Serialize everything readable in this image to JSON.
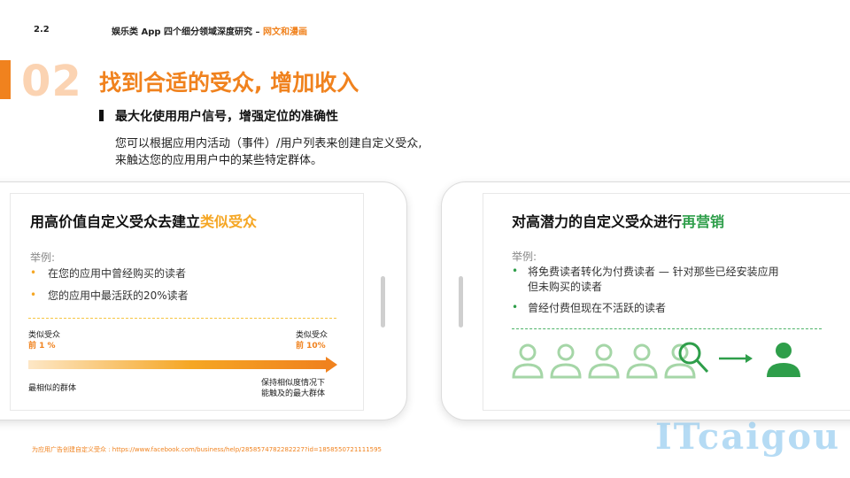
{
  "header": {
    "section_number": "2.2",
    "title": "娱乐类 App 四个细分领域深度研究 – ",
    "title_accent": "网文和漫画"
  },
  "slide": {
    "big_number": "02",
    "title": "找到合适的受众, 增加收入",
    "subtitle": "最大化使用用户信号，增强定位的准确性",
    "description_line1": "您可以根据应用内活动（事件）/用户列表来创建自定义受众,",
    "description_line2": "来触达您的应用用户中的某些特定群体。"
  },
  "left_card": {
    "title_prefix": "用高价值自定义受众去建立",
    "title_highlight": "类似受众",
    "example_label": "举例:",
    "bullets": [
      "在您的应用中曾经购买的读者",
      "您的应用中最活跃的20%读者"
    ],
    "scale": {
      "left_label_line1": "类似受众",
      "left_label_line2": "前 1 %",
      "right_label_line1": "类似受众",
      "right_label_line2": "前 10%",
      "left_caption": "最相似的群体",
      "right_caption_line1": "保持相似度情况下",
      "right_caption_line2": "能触及的最大群体"
    }
  },
  "right_card": {
    "title_prefix": "对高潜力的自定义受众进行",
    "title_highlight": "再营销",
    "example_label": "举例:",
    "bullets": [
      {
        "line1": "将免费读者转化为付费读者 — 针对那些已经安装应用",
        "line2": "但未购买的读者"
      },
      {
        "line1": "曾经付费但现在不活跃的读者",
        "line2": ""
      }
    ],
    "icons": [
      "person-outline-icon",
      "person-outline-icon",
      "person-outline-icon",
      "person-outline-icon",
      "person-outline-icon",
      "magnifier-icon",
      "arrow-right-icon",
      "person-solid-icon"
    ]
  },
  "source": "为应用广告创建自定义受众 : https://www.facebook.com/business/help/2858574782282227?id=1858550721111595",
  "watermark": "ITcaigou",
  "colors": {
    "accent_orange": "#f0821e",
    "highlight_yellow": "#f5a623",
    "green": "#2e9e4a",
    "light_green": "#c8e6c9"
  }
}
